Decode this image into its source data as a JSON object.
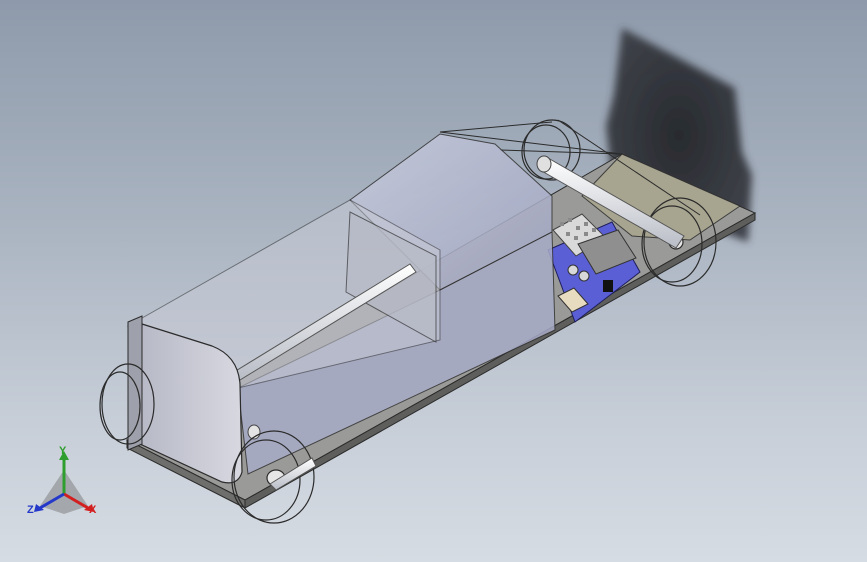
{
  "viewport": {
    "model": "chassis-assembly",
    "background_top": "#8e9aab",
    "background_bottom": "#d6dce3"
  },
  "triad": {
    "x_label": "X",
    "y_label": "Y",
    "z_label": "Z",
    "x_color": "#d21f1f",
    "y_color": "#2e9e2e",
    "z_color": "#2438c9"
  }
}
